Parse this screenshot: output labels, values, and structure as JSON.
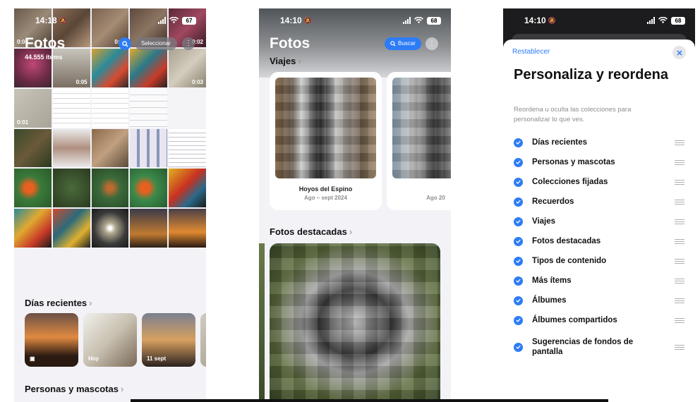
{
  "phone1": {
    "status": {
      "time": "14:18",
      "battery": "67"
    },
    "title": "Fotos",
    "count": "44.555 ítems",
    "select_label": "Seleccionar",
    "more_label": "⋮",
    "durations": [
      "0:08",
      "0:13",
      "0:02",
      "0:05",
      "0:03",
      "0:01"
    ],
    "recent_title": "Días recientes",
    "recent_cards": [
      "Hoy",
      "11 sept"
    ],
    "people_title": "Personas y mascotas"
  },
  "phone2": {
    "status": {
      "time": "14:10",
      "battery": "68"
    },
    "title": "Fotos",
    "search_label": "Buscar",
    "trips_title": "Viajes",
    "trips": [
      {
        "name": "Hoyos del Espino",
        "date": "Ago – sept 2024"
      },
      {
        "name": "",
        "date": "Ago 20"
      }
    ],
    "featured_title": "Fotos destacadas"
  },
  "phone3": {
    "status": {
      "time": "14:10",
      "battery": "68"
    },
    "reset_label": "Restablecer",
    "title": "Personaliza y reordena",
    "description": "Reordena u oculta las colecciones para personalizar lo que ves.",
    "items": [
      "Días recientes",
      "Personas y mascotas",
      "Colecciones fijadas",
      "Recuerdos",
      "Viajes",
      "Fotos destacadas",
      "Tipos de contenido",
      "Más ítems",
      "Álbumes",
      "Álbumes compartidos",
      "Sugerencias de fondos de pantalla"
    ]
  },
  "colors": {
    "accent": "#2d7cf6",
    "background": "#f2f2f7"
  }
}
